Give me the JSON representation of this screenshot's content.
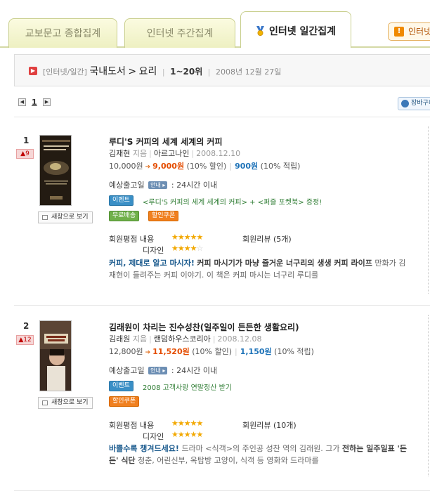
{
  "tabs": {
    "kyobo_total": "교보문고 종합집계",
    "internet_weekly": "인터넷 주간집계",
    "internet_daily": "인터넷 일간집계",
    "side_tab": "인터넷"
  },
  "breadcrumb": {
    "category_prefix": "[인터넷/일간]",
    "domestic": "국내도서",
    "arrow": ">",
    "genre": "요리",
    "range": "1~20위",
    "date": "2008년 12월 27일"
  },
  "pager": {
    "prev": "◀",
    "page": "1",
    "next": "▶"
  },
  "cart_button": "장바구니",
  "items": [
    {
      "rank": "1",
      "rank_change": "▲9",
      "new_window": "새창으로 보기",
      "title": "루디'S 커피의 세계 세계의 커피",
      "author": "김재현",
      "author_role": "지음",
      "publisher": "아르고나인",
      "pub_date": "2008.12.10",
      "list_price": "10,000원",
      "sale_price": "9,000원",
      "discount": "(10% 할인)",
      "points": "900원",
      "points_rate": "(10% 적립)",
      "ship_label": "예상출고일",
      "ship_guide": "안내",
      "ship_value": ": 24시간 이내",
      "event_badge": "이벤트",
      "event_text": "<루디'S 커피의 세계 세계의 커피> + <퍼즐 포켓북> 증정!",
      "free_ship_badge": "무료배송",
      "coupon_badge": "할인쿠폰",
      "rating_label": "회원평점",
      "content_label": "내용",
      "design_label": "디자인",
      "content_stars": "★★★★★",
      "design_stars": "★★★★",
      "design_stars_empty": "☆",
      "review_label": "회원리뷰 (5개)",
      "desc_highlight": "커피, 제대로 알고 마시자!",
      "desc_bold": "커피 마시기가 마냥 즐거운 너구리의 생생 커피 라이프",
      "desc_text": "만화가 김재현이 들려주는 커피 이야기. 이 책은 커피 마시는 너구리 루디를"
    },
    {
      "rank": "2",
      "rank_change": "▲12",
      "new_window": "새창으로 보기",
      "title": "김래원이 차리는 진수성찬(일주일이 든든한 생활요리)",
      "author": "김래원",
      "author_role": "지음",
      "publisher": "랜덤하우스코리아",
      "pub_date": "2008.12.08",
      "list_price": "12,800원",
      "sale_price": "11,520원",
      "discount": "(10% 할인)",
      "points": "1,150원",
      "points_rate": "(10% 적립)",
      "ship_label": "예상출고일",
      "ship_guide": "안내",
      "ship_value": ": 24시간 이내",
      "event_badge": "이벤트",
      "event_text": "2008 고객사랑 연말정산 받기",
      "coupon_badge": "할인쿠폰",
      "rating_label": "회원평점",
      "content_label": "내용",
      "design_label": "디자인",
      "content_stars": "★★★★★",
      "design_stars": "★★★★★",
      "review_label": "회원리뷰 (10개)",
      "desc_highlight": "바쁠수록 챙겨드세요!",
      "desc_bold": "전하는 일주일표 '든든' 식단",
      "desc_text_a": "드라마 <식객>의 주인공 성찬 역의 김래원. 그가",
      "desc_text_b": "청춘, 어린신부, 옥탑방 고양이, 식객 등 영화와 드라마를"
    }
  ],
  "colors": {
    "accent_orange": "#e44c00",
    "points_blue": "#1d72b8",
    "tab_bg": "#eef0c2",
    "event_green": "#2f7d34"
  }
}
